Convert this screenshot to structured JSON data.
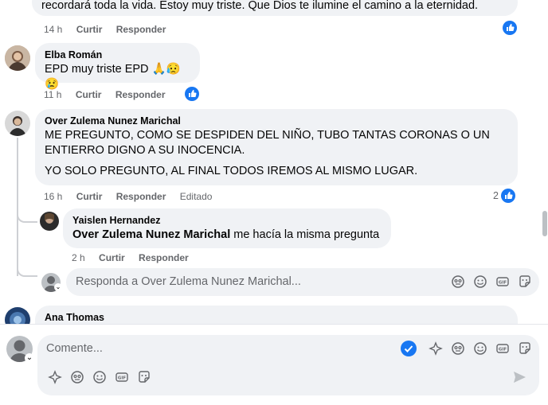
{
  "comments": [
    {
      "text_tail": "recordará toda la vida. Estoy muy triste. Que Dios te ilumine el camino a la eternidad.",
      "time": "14 h",
      "like_label": "Curtir",
      "reply_label": "Responder"
    },
    {
      "author": "Elba Román",
      "text": "EPD muy triste EPD 🙏😥😢",
      "time": "11 h",
      "like_label": "Curtir",
      "reply_label": "Responder"
    },
    {
      "author": "Over Zulema Nunez Marichal",
      "text_line1": "ME PREGUNTO, COMO SE DESPIDEN DEL NIÑO, TUBO TANTAS CORONAS O UN",
      "text_line2": "ENTIERRO DIGNO A SU INOCENCIA.",
      "text_line3": "YO SOLO PREGUNTO, AL FINAL TODOS IREMOS AL MISMO LUGAR.",
      "time": "16 h",
      "like_label": "Curtir",
      "reply_label": "Responder",
      "edited_label": "Editado",
      "reaction_count": "2"
    },
    {
      "author": "Ana Thomas"
    }
  ],
  "reply": {
    "author": "Yaislen Hernandez",
    "mention": "Over Zulema Nunez Marichal",
    "text": " me hacía la misma pregunta",
    "time": "2 h",
    "like_label": "Curtir",
    "reply_label": "Responder"
  },
  "reply_input": {
    "placeholder": "Responda a Over Zulema Nunez Marichal..."
  },
  "composer": {
    "placeholder": "Comente..."
  },
  "colors": {
    "accent": "#1877f2",
    "bubble": "#f0f2f5",
    "meta_text": "#65676b"
  },
  "icons": [
    "like-icon",
    "avatar-icon",
    "sticker-icon",
    "avatar-sticker-icon",
    "emoji-icon",
    "gif-icon",
    "stickers-face-icon",
    "send-icon",
    "checkmark-icon"
  ]
}
